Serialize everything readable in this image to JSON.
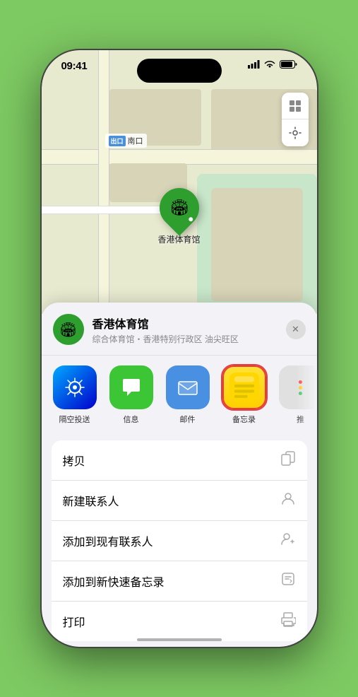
{
  "status_bar": {
    "time": "09:41",
    "signal_bars": "▌▌▌",
    "wifi": "wifi",
    "battery": "battery"
  },
  "map": {
    "label_badge": "出口",
    "label_text": "南口",
    "pin_emoji": "🏟",
    "pin_label": "香港体育馆",
    "control_map": "🗺",
    "control_location": "➤"
  },
  "sheet": {
    "venue_emoji": "🏟",
    "venue_name": "香港体育馆",
    "venue_subtitle": "综合体育馆・香港特别行政区 油尖旺区",
    "close_icon": "✕"
  },
  "share_items": [
    {
      "id": "airdrop",
      "label": "隔空投送",
      "emoji": "📡"
    },
    {
      "id": "messages",
      "label": "信息",
      "emoji": "💬"
    },
    {
      "id": "mail",
      "label": "邮件",
      "emoji": "✉️"
    },
    {
      "id": "notes",
      "label": "备忘录",
      "emoji": "notes"
    },
    {
      "id": "more",
      "label": "推",
      "emoji": "···"
    }
  ],
  "actions": [
    {
      "id": "copy",
      "label": "拷贝",
      "icon": "copy"
    },
    {
      "id": "new-contact",
      "label": "新建联系人",
      "icon": "person"
    },
    {
      "id": "add-existing",
      "label": "添加到现有联系人",
      "icon": "person-add"
    },
    {
      "id": "add-notes",
      "label": "添加到新快速备忘录",
      "icon": "notes-add"
    },
    {
      "id": "print",
      "label": "打印",
      "icon": "print"
    }
  ]
}
